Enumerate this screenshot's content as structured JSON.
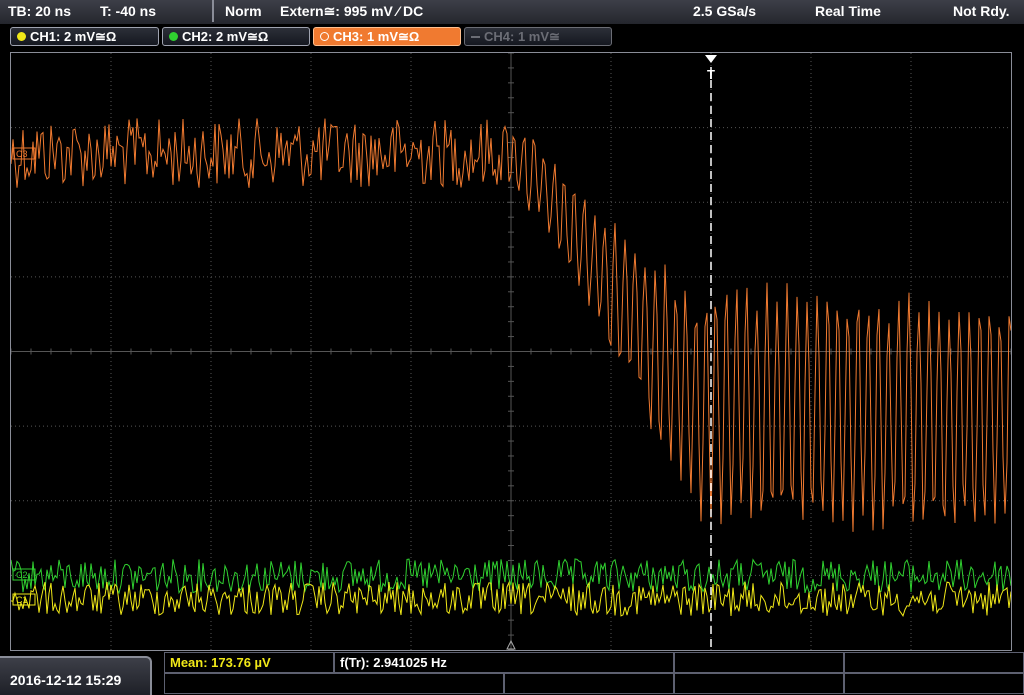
{
  "status_bar": {
    "timebase": "TB: 20 ns",
    "trigger_time": "T: -40 ns",
    "acq_mode": "Norm",
    "trigger_source": "Extern≅: 995 mV ⁄ DC",
    "sample_rate": "2.5 GSa/s",
    "mode": "Real Time",
    "state": "Not Rdy."
  },
  "channels": [
    {
      "label": "CH1: 2 mV≅Ω",
      "color": "#f0e818",
      "active": false,
      "enabled": true
    },
    {
      "label": "CH2: 2 mV≅Ω",
      "color": "#30d030",
      "active": false,
      "enabled": true
    },
    {
      "label": "CH3: 1 mV≅Ω",
      "color": "#f07a30",
      "active": true,
      "enabled": true
    },
    {
      "label": "CH4: 1 mV≅",
      "color": "#6b6d75",
      "active": false,
      "enabled": false
    }
  ],
  "markers": {
    "trigger": "T",
    "ch1_ref": "C1",
    "ch2_ref": "C2",
    "ch3_ref": "C3"
  },
  "footer": {
    "datetime": "2016-12-12 15:29",
    "mean": "Mean: 173.76 µV",
    "freq": "f(Tr): 2.941025 Hz"
  },
  "colors": {
    "ch1": "#f0e818",
    "ch2": "#30d030",
    "ch3": "#f07a30",
    "grid": "#555555"
  }
}
